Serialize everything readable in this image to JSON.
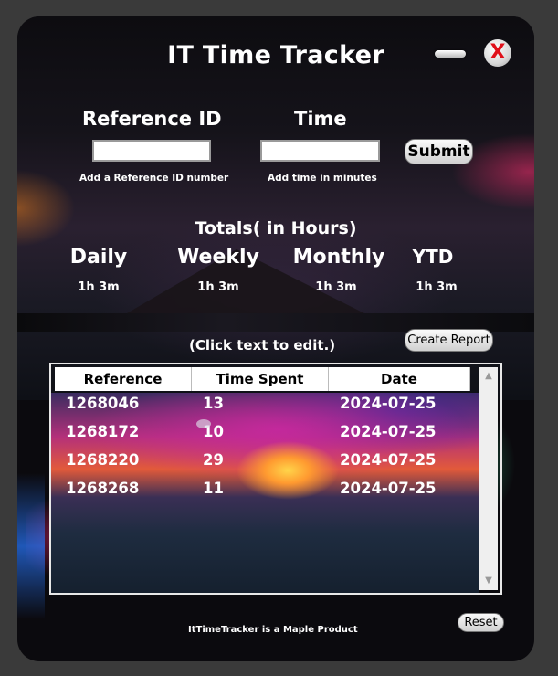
{
  "app": {
    "title": "IT Time Tracker",
    "close_label": "X"
  },
  "form": {
    "reference_label": "Reference  ID",
    "time_label": "Time",
    "reference_value": "",
    "time_value": "",
    "reference_hint": "Add a Reference ID number",
    "time_hint": "Add time in minutes",
    "submit_label": "Submit"
  },
  "totals": {
    "heading": "Totals( in Hours)",
    "daily_label": "Daily",
    "weekly_label": "Weekly",
    "monthly_label": "Monthly",
    "ytd_label": "YTD",
    "daily_value": "1h 3m",
    "weekly_value": "1h 3m",
    "monthly_value": "1h 3m",
    "ytd_value": "1h 3m"
  },
  "table": {
    "edit_hint": "(Click text to edit.)",
    "create_report_label": "Create Report",
    "columns": [
      "Reference",
      "Time Spent",
      "Date"
    ],
    "rows": [
      {
        "reference": "1268046",
        "time": "13",
        "date": "2024-07-25"
      },
      {
        "reference": "1268172",
        "time": "10",
        "date": "2024-07-25"
      },
      {
        "reference": "1268220",
        "time": "29",
        "date": "2024-07-25"
      },
      {
        "reference": "1268268",
        "time": "11",
        "date": "2024-07-25"
      }
    ]
  },
  "footer": {
    "product_text": "ItTimeTracker is a Maple Product",
    "reset_label": "Reset"
  },
  "icons": {
    "minimize": "minimize-icon",
    "close": "close-icon",
    "scroll_up": "chevron-up-icon",
    "scroll_down": "chevron-down-icon"
  }
}
